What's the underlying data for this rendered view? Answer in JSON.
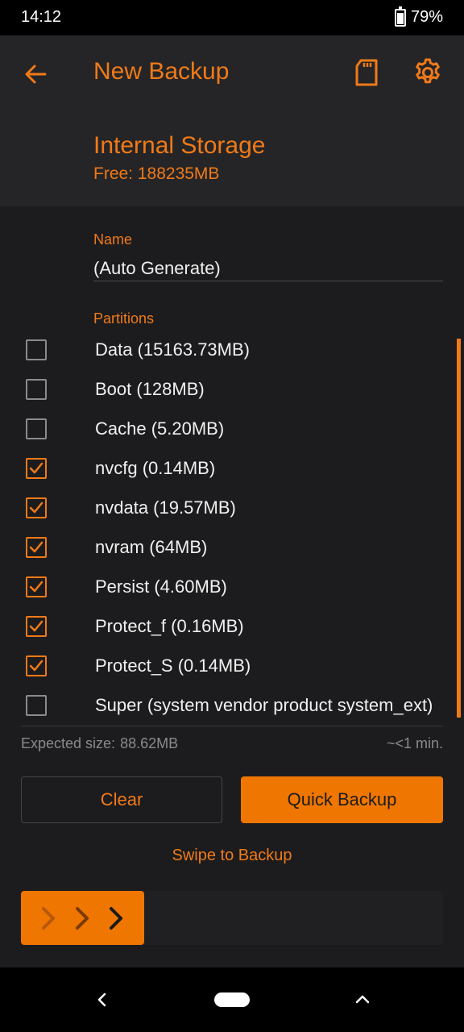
{
  "status_bar": {
    "time": "14:12",
    "battery": "79%"
  },
  "app_bar": {
    "title": "New Backup"
  },
  "storage": {
    "name": "Internal Storage",
    "free": "Free: 188235MB"
  },
  "name_field": {
    "label": "Name",
    "value": "(Auto Generate)"
  },
  "partitions_label": "Partitions",
  "partitions": [
    {
      "label": "Data (15163.73MB)",
      "checked": false
    },
    {
      "label": "Boot (128MB)",
      "checked": false
    },
    {
      "label": "Cache (5.20MB)",
      "checked": false
    },
    {
      "label": "nvcfg (0.14MB)",
      "checked": true
    },
    {
      "label": "nvdata (19.57MB)",
      "checked": true
    },
    {
      "label": "nvram (64MB)",
      "checked": true
    },
    {
      "label": "Persist (4.60MB)",
      "checked": true
    },
    {
      "label": "Protect_f (0.16MB)",
      "checked": true
    },
    {
      "label": "Protect_S (0.14MB)",
      "checked": true
    },
    {
      "label": "Super (system vendor product system_ext)",
      "checked": false
    }
  ],
  "summary": {
    "expected_label": "Expected size:",
    "expected_value": "88.62MB",
    "time": "~<1 min."
  },
  "buttons": {
    "clear": "Clear",
    "quick_backup": "Quick Backup"
  },
  "swipe": {
    "label": "Swipe to Backup"
  },
  "colors": {
    "accent": "#ef7600",
    "background": "#1c1c1e",
    "header": "#252527"
  },
  "icons": {
    "back": "arrow-left-icon",
    "storage": "sd-card-icon",
    "settings": "gear-icon",
    "swipe": "chevrons-right-icon"
  }
}
